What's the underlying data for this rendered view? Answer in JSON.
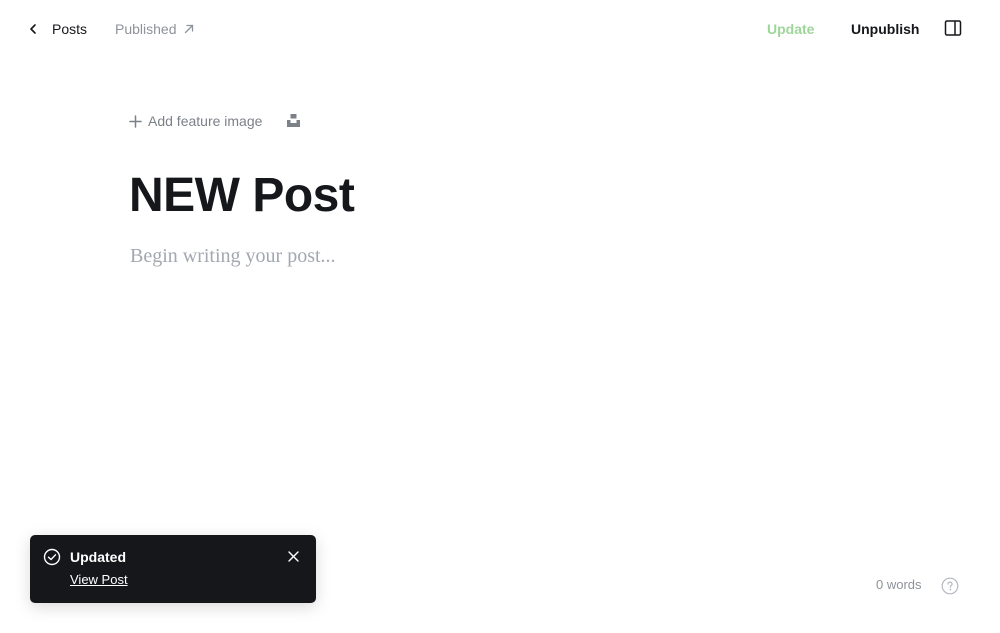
{
  "header": {
    "back_label": "Posts",
    "status_label": "Published",
    "update_label": "Update",
    "unpublish_label": "Unpublish",
    "icons": {
      "back": "chevron-left-icon",
      "status": "arrow-up-right-icon",
      "sidebar": "sidebar-panel-icon"
    }
  },
  "editor": {
    "add_feature_label": "Add feature image",
    "title": "NEW Post",
    "body_placeholder": "Begin writing your post...",
    "icons": {
      "add": "plus-icon",
      "unsplash": "unsplash-icon"
    }
  },
  "toast": {
    "title": "Updated",
    "link_label": "View Post",
    "icons": {
      "status": "check-circle-icon",
      "close": "close-icon"
    }
  },
  "footer": {
    "word_count": "0 words",
    "icons": {
      "help": "help-circle-icon"
    }
  },
  "colors": {
    "text": "#15171a",
    "muted": "#8e9299",
    "update_green": "#9ed69a",
    "toast_bg": "#15171a",
    "placeholder": "#a3a8b0"
  }
}
